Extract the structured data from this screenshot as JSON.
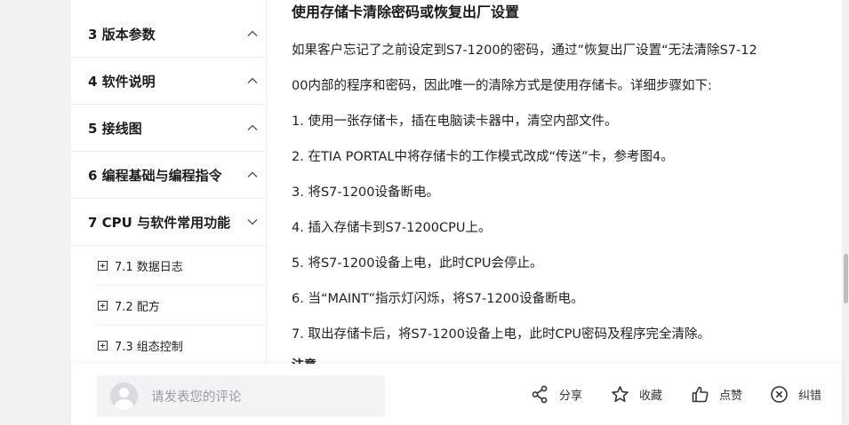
{
  "sidebar": {
    "sections": [
      {
        "label": "3 版本参数",
        "chevron": "chevron-up-icon"
      },
      {
        "label": "4 软件说明",
        "chevron": "chevron-up-icon"
      },
      {
        "label": "5 接线图",
        "chevron": "chevron-up-icon"
      },
      {
        "label": "6 编程基础与编程指令",
        "chevron": "chevron-up-icon"
      },
      {
        "label": "7 CPU 与软件常用功能",
        "chevron": "chevron-down-icon"
      }
    ],
    "subitems": [
      {
        "label": "7.1 数据日志"
      },
      {
        "label": "7.2 配方"
      },
      {
        "label": "7.3 组态控制"
      }
    ]
  },
  "article": {
    "heading": "使用存储卡清除密码或恢复出厂设置",
    "intro_line1": "如果客户忘记了之前设定到S7-1200的密码，通过”恢复出厂设置“无法清除S7-12",
    "intro_line2": "00内部的程序和密码，因此唯一的清除方式是使用存储卡。详细步骤如下:",
    "steps": [
      "1. 使用一张存储卡，插在电脑读卡器中，清空内部文件。",
      "2. 在TIA PORTAL中将存储卡的工作模式改成“传送”卡，参考图4。",
      "3. 将S7-1200设备断电。",
      "4. 插入存储卡到S7-1200CPU上。",
      "5. 将S7-1200设备上电，此时CPU会停止。",
      "6. 当“MAINT”指示灯闪烁，将S7-1200设备断电。",
      "7. 取出存储卡后，将S7-1200设备上电，此时CPU密码及程序完全清除。"
    ],
    "note_partial": "注意"
  },
  "bottom_bar": {
    "comment_placeholder": "请发表您的评论",
    "share_label": "分享",
    "favorite_label": "收藏",
    "like_label": "点赞",
    "report_label": "纠错"
  },
  "colors": {
    "accent_text": "#1c1c1c",
    "placeholder": "#9a9ca3",
    "background": "#f1f2f4"
  }
}
